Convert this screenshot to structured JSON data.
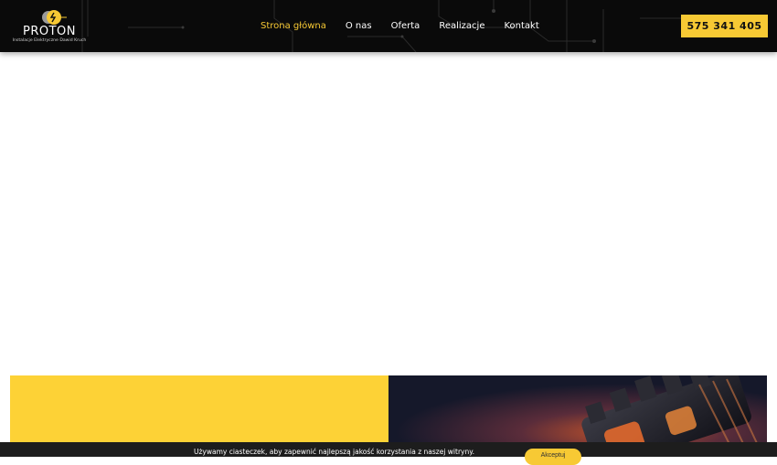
{
  "brand": {
    "name": "PROTON",
    "tagline": "Instalacje Elektryczne Dawid Kruch"
  },
  "nav": {
    "items": [
      {
        "label": "Strona główna",
        "active": true
      },
      {
        "label": "O nas",
        "active": false
      },
      {
        "label": "Oferta",
        "active": false
      },
      {
        "label": "Realizacje",
        "active": false
      },
      {
        "label": "Kontakt",
        "active": false
      }
    ]
  },
  "phone": {
    "label": "575 341 405"
  },
  "cookie": {
    "text": "Używamy ciasteczek, aby zapewnić najlepszą jakość korzystania z naszej witryny.",
    "accept_label": "Akceptuj"
  },
  "colors": {
    "accent": "#f7c934",
    "header_bg": "#0a0a0a",
    "panel_yellow": "#fdd236"
  }
}
